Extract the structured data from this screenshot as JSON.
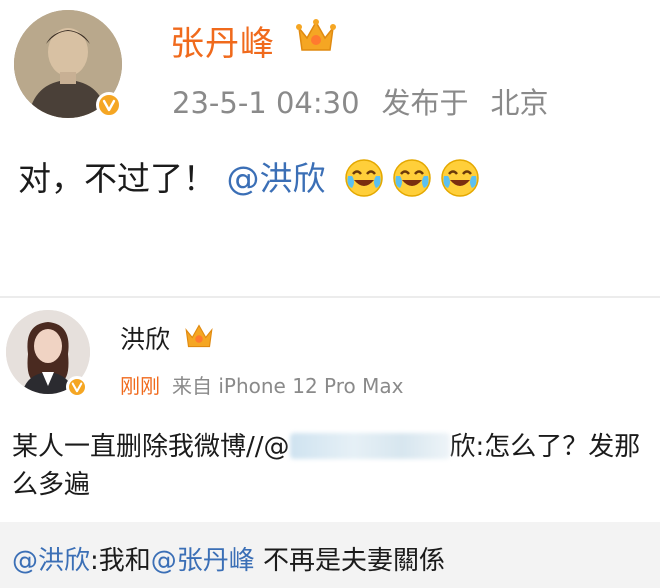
{
  "post": {
    "author": "张丹峰",
    "timestamp": "23-5-1 04:30",
    "published": "发布于",
    "location": "北京",
    "text": "对，不过了！",
    "mention": "@洪欣",
    "emoji_icon": "laugh-cry-icon"
  },
  "quoted": {
    "author": "洪欣",
    "time": "刚刚",
    "source": "来自 iPhone 12 Pro Max",
    "text_before": "某人一直删除我微博//@",
    "text_after": "欣:怎么了？发那么多遍",
    "footer_mention": "@洪欣",
    "footer_text_1": ":我和",
    "footer_mention_2": "@张丹峰",
    "footer_text_2": " 不再是夫妻關係"
  },
  "colors": {
    "name_orange": "#f06a1c",
    "mention_blue": "#3b6fb6",
    "meta_gray": "#8a8a8a",
    "badge_gold": "#f5a623"
  }
}
